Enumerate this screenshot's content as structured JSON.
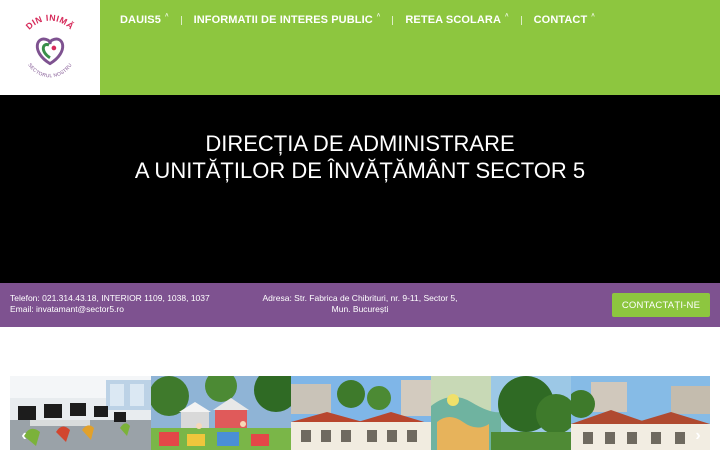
{
  "logo": {
    "name": "din-inima-logo",
    "top_text": "DIN INIMĂ",
    "bottom_text": "SECTORUL NOSTRU",
    "colors": {
      "ring": "#d62a5a",
      "heart": "#3a8f4a",
      "purple": "#7e5290"
    }
  },
  "nav": {
    "items": [
      {
        "label": "DAUIS5",
        "arrow": "˄"
      },
      {
        "label": "INFORMATII DE INTERES PUBLIC",
        "arrow": "˄"
      },
      {
        "label": "RETEA SCOLARA",
        "arrow": "˄"
      },
      {
        "label": "CONTACT",
        "arrow": "˄"
      }
    ]
  },
  "hero": {
    "line1": "DIRECȚIA DE ADMINISTRARE",
    "line2": "A UNITĂȚILOR DE ÎNVĂȚĂMÂNT SECTOR 5"
  },
  "info": {
    "phone": "Telefon: 021.314.43.18, INTERIOR 1109, 1038, 1037",
    "email": "Email: invatamant@sector5.ro",
    "address_line1": "Adresa: Str. Fabrica de Chibrituri, nr. 9-11, Sector 5,",
    "address_line2": "Mun. București",
    "cta_label": "CONTACTAȚI-NE"
  },
  "gallery": {
    "prev_icon": "‹",
    "next_icon": "›",
    "photos": [
      "computer-lab-photo",
      "playground-photo",
      "school-building-photo",
      "painted-wall-photo",
      "school-courtyard-photo"
    ]
  },
  "colors": {
    "header_green": "#8dc63f",
    "hero_black": "#000000",
    "info_purple": "#7e5290",
    "button_green": "#8dc63f"
  }
}
